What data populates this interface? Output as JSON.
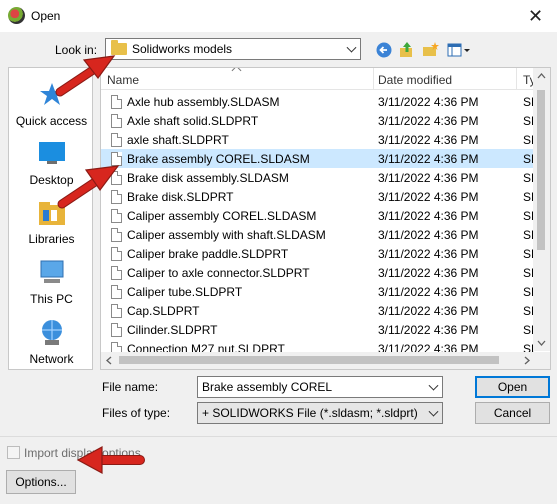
{
  "window": {
    "title": "Open",
    "close_glyph": "✕"
  },
  "lookin": {
    "label": "Look in:",
    "value": "Solidworks models"
  },
  "toolbar": {
    "back_icon": "back-arrow-icon",
    "up_icon": "up-folder-icon",
    "new_folder_icon": "new-folder-icon",
    "view_icon": "view-menu-icon"
  },
  "places": [
    {
      "label": "Quick access",
      "icon": "pin-star-icon"
    },
    {
      "label": "Desktop",
      "icon": "desktop-icon"
    },
    {
      "label": "Libraries",
      "icon": "libraries-icon"
    },
    {
      "label": "This PC",
      "icon": "computer-icon"
    },
    {
      "label": "Network",
      "icon": "network-icon"
    }
  ],
  "columns": {
    "name": "Name",
    "date": "Date modified",
    "type": "Ty"
  },
  "files": [
    {
      "name": "Axle hub assembly.SLDASM",
      "date": "3/11/2022 4:36 PM",
      "type": "SL",
      "selected": false
    },
    {
      "name": "Axle shaft solid.SLDPRT",
      "date": "3/11/2022 4:36 PM",
      "type": "SL",
      "selected": false
    },
    {
      "name": "axle shaft.SLDPRT",
      "date": "3/11/2022 4:36 PM",
      "type": "SL",
      "selected": false
    },
    {
      "name": "Brake assembly COREL.SLDASM",
      "date": "3/11/2022 4:36 PM",
      "type": "SL",
      "selected": true
    },
    {
      "name": "Brake disk assembly.SLDASM",
      "date": "3/11/2022 4:36 PM",
      "type": "SL",
      "selected": false
    },
    {
      "name": "Brake disk.SLDPRT",
      "date": "3/11/2022 4:36 PM",
      "type": "SL",
      "selected": false
    },
    {
      "name": "Caliper assembly COREL.SLDASM",
      "date": "3/11/2022 4:36 PM",
      "type": "SL",
      "selected": false
    },
    {
      "name": "Caliper assembly with shaft.SLDASM",
      "date": "3/11/2022 4:36 PM",
      "type": "SL",
      "selected": false
    },
    {
      "name": "Caliper brake paddle.SLDPRT",
      "date": "3/11/2022 4:36 PM",
      "type": "SL",
      "selected": false
    },
    {
      "name": "Caliper to axle connector.SLDPRT",
      "date": "3/11/2022 4:36 PM",
      "type": "SL",
      "selected": false
    },
    {
      "name": "Caliper tube.SLDPRT",
      "date": "3/11/2022 4:36 PM",
      "type": "SL",
      "selected": false
    },
    {
      "name": "Cap.SLDPRT",
      "date": "3/11/2022 4:36 PM",
      "type": "SL",
      "selected": false
    },
    {
      "name": "Cilinder.SLDPRT",
      "date": "3/11/2022 4:36 PM",
      "type": "SL",
      "selected": false
    },
    {
      "name": "Connection M27 nut.SLDPRT",
      "date": "3/11/2022 4:36 PM",
      "type": "SL",
      "selected": false
    }
  ],
  "filename": {
    "label": "File name:",
    "value": "Brake assembly COREL"
  },
  "filetype": {
    "label": "Files of type:",
    "value": "+ SOLIDWORKS File (*.sldasm; *.sldprt)"
  },
  "buttons": {
    "open": "Open",
    "cancel": "Cancel",
    "options": "Options..."
  },
  "import_display": {
    "label": "Import display options",
    "checked": false
  },
  "colors": {
    "selection": "#cce8ff",
    "accent": "#0078d7",
    "annotation_arrow": "#d7261e"
  }
}
